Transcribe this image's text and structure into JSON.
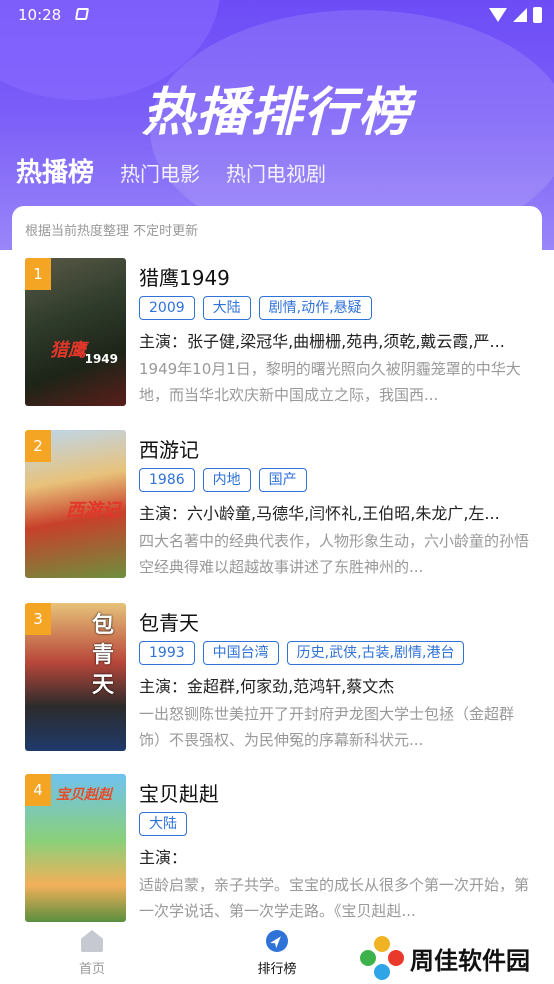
{
  "status_bar": {
    "time": "10:28"
  },
  "hero": {
    "title": "热播排行榜"
  },
  "tabs": [
    {
      "label": "热播榜",
      "active": true
    },
    {
      "label": "热门电影",
      "active": false
    },
    {
      "label": "热门电视剧",
      "active": false
    }
  ],
  "note": "根据当前热度整理 不定时更新",
  "items": [
    {
      "rank": "1",
      "title": "猎鹰1949",
      "tags": [
        "2009",
        "大陆",
        "剧情,动作,悬疑"
      ],
      "cast": "主演：张子健,梁冠华,曲栅栅,苑冉,须乾,戴云霞,严...",
      "desc": "1949年10月1日，黎明的曙光照向久被阴霾笼罩的中华大地，而当华北欢庆新中国成立之际，我国西...",
      "poster_text": "猎鹰",
      "poster_year": "1949"
    },
    {
      "rank": "2",
      "title": "西游记",
      "tags": [
        "1986",
        "内地",
        "国产"
      ],
      "cast": "主演：六小龄童,马德华,闫怀礼,王伯昭,朱龙广,左...",
      "desc": "四大名著中的经典代表作，人物形象生动，六小龄童的孙悟空经典得难以超越故事讲述了东胜神州的...",
      "poster_text": "西游记"
    },
    {
      "rank": "3",
      "title": "包青天",
      "tags": [
        "1993",
        "中国台湾",
        "历史,武侠,古装,剧情,港台"
      ],
      "cast": "主演：金超群,何家劲,范鸿轩,蔡文杰",
      "desc": "一出怒铡陈世美拉开了开封府尹龙图大学士包拯（金超群饰）不畏强权、为民伸冤的序幕新科状元...",
      "poster_text": "包青天"
    },
    {
      "rank": "4",
      "title": "宝贝赳赳",
      "tags": [
        "大陆"
      ],
      "cast": "主演：",
      "desc": "适龄启蒙，亲子共学。宝宝的成长从很多个第一次开始，第一次学说话、第一次学走路。《宝贝赳赳...",
      "poster_text": "宝贝赳赳"
    }
  ],
  "bottom_nav": [
    {
      "label": "首页",
      "icon": "home-icon",
      "active": false
    },
    {
      "label": "排行榜",
      "icon": "compass-icon",
      "active": true
    }
  ],
  "watermark": {
    "text": "周佳软件园"
  },
  "colors": {
    "accent": "#2f72d8",
    "rank_badge": "#f5a524",
    "hero_top": "#6d4cf7"
  }
}
